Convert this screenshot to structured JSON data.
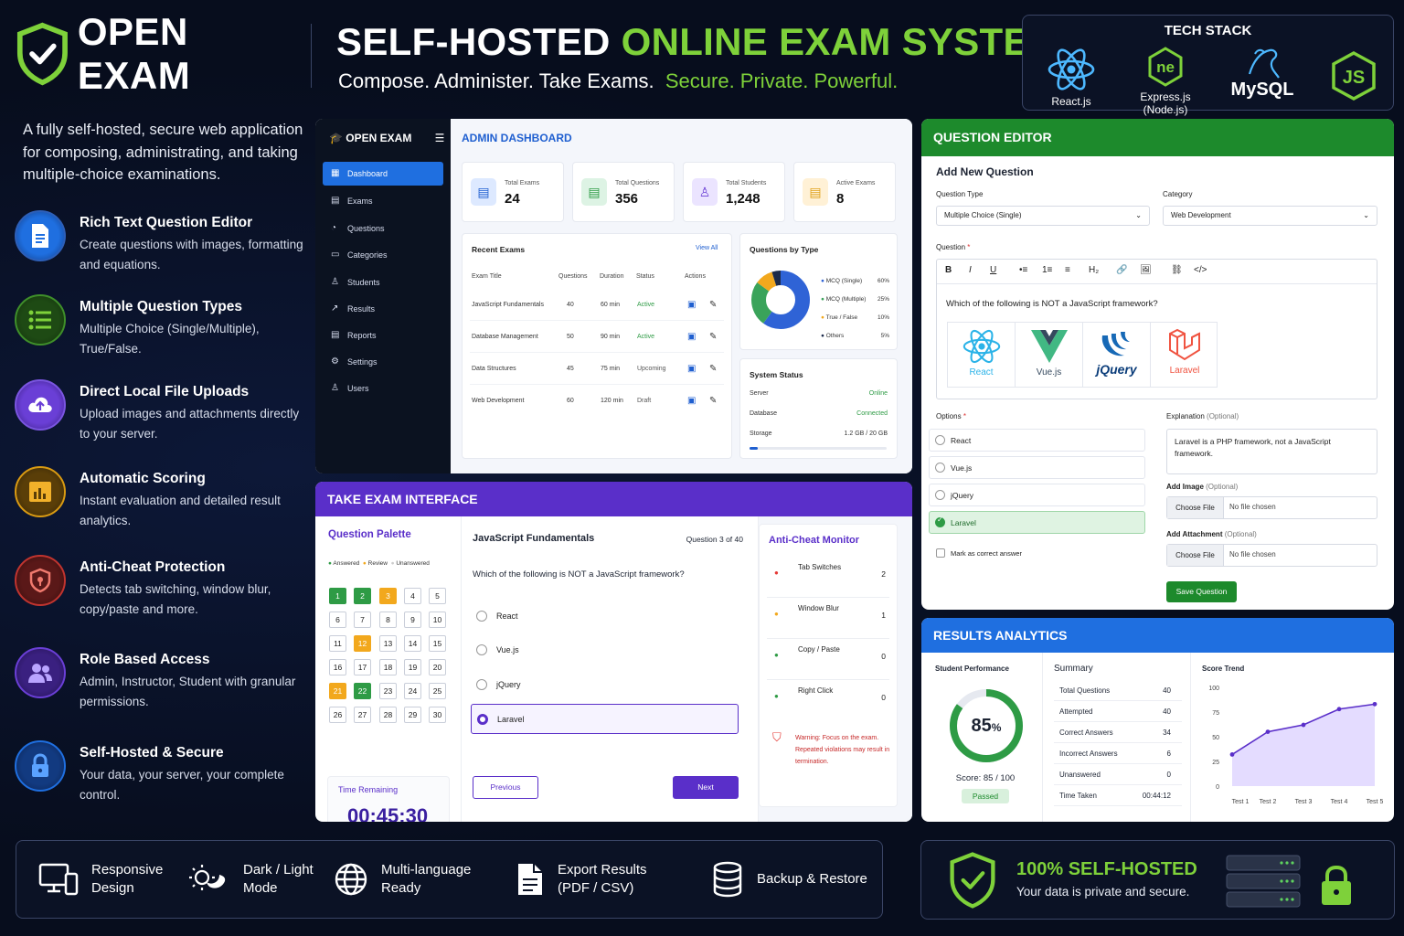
{
  "brand": {
    "name": "OPEN EXAM"
  },
  "headline": {
    "part1": "SELF-HOSTED",
    "part2": "ONLINE EXAM SYSTEM"
  },
  "tagline": {
    "part1": "Compose. Administer. Take Exams.",
    "part2": "Secure. Private. Powerful."
  },
  "tech_stack": {
    "title": "TECH STACK",
    "items": [
      {
        "label": "React.js",
        "icon": "react-icon"
      },
      {
        "label": "Express.js (Node.js)",
        "icon": "node-icon"
      },
      {
        "label": "MySQL",
        "icon": "mysql-icon"
      },
      {
        "label": "",
        "icon": "js-icon"
      }
    ]
  },
  "intro": "A fully self-hosted, secure web application for composing, administrating, and taking multiple-choice examinations.",
  "features": [
    {
      "title": "Rich Text Question Editor",
      "desc": "Create questions with images, formatting and equations.",
      "icon": "document-icon",
      "color": "#1f6fe0"
    },
    {
      "title": "Multiple Question Types",
      "desc": "Multiple Choice (Single/Multiple), True/False.",
      "icon": "list-icon",
      "color": "#3f8f2a"
    },
    {
      "title": "Direct Local File Uploads",
      "desc": "Upload images and attachments directly to your server.",
      "icon": "cloud-upload-icon",
      "color": "#6a3fd6"
    },
    {
      "title": "Automatic Scoring",
      "desc": "Instant evaluation and detailed result analytics.",
      "icon": "chart-icon",
      "color": "#d99a12"
    },
    {
      "title": "Anti-Cheat Protection",
      "desc": "Detects tab switching, window blur, copy/paste and more.",
      "icon": "shield-icon",
      "color": "#c0342f"
    },
    {
      "title": "Role Based Access",
      "desc": "Admin, Instructor, Student with granular permissions.",
      "icon": "users-icon",
      "color": "#6a3fd6"
    },
    {
      "title": "Self-Hosted & Secure",
      "desc": "Your data, your server, your complete control.",
      "icon": "lock-icon",
      "color": "#1f6fe0"
    }
  ],
  "admin": {
    "logo": "OPEN EXAM",
    "title": "ADMIN DASHBOARD",
    "menu": [
      "Dashboard",
      "Exams",
      "Questions",
      "Categories",
      "Students",
      "Results",
      "Reports",
      "Settings",
      "Users"
    ],
    "stats": [
      {
        "label": "Total Exams",
        "value": "24"
      },
      {
        "label": "Total Questions",
        "value": "356"
      },
      {
        "label": "Total Students",
        "value": "1,248"
      },
      {
        "label": "Active Exams",
        "value": "8"
      }
    ],
    "recent": {
      "title": "Recent Exams",
      "view_all": "View All",
      "headers": [
        "Exam Title",
        "Questions",
        "Duration",
        "Status",
        "Actions"
      ],
      "rows": [
        [
          "JavaScript Fundamentals",
          "40",
          "60 min",
          "Active"
        ],
        [
          "Database Management",
          "50",
          "90 min",
          "Active"
        ],
        [
          "Data Structures",
          "45",
          "75 min",
          "Upcoming"
        ],
        [
          "Web Development",
          "60",
          "120 min",
          "Draft"
        ]
      ]
    },
    "by_type": {
      "title": "Questions by Type",
      "items": [
        {
          "label": "MCQ (Single)",
          "value": "60%",
          "pct": 60,
          "color": "#2f63d6"
        },
        {
          "label": "MCQ (Multiple)",
          "value": "25%",
          "pct": 25,
          "color": "#3aa35a"
        },
        {
          "label": "True / False",
          "value": "10%",
          "pct": 10,
          "color": "#f2a81d"
        },
        {
          "label": "Others",
          "value": "5%",
          "pct": 5,
          "color": "#1b2a4a"
        }
      ]
    },
    "system": {
      "title": "System Status",
      "rows": [
        {
          "label": "Server",
          "value": "Online"
        },
        {
          "label": "Database",
          "value": "Connected"
        },
        {
          "label": "Storage",
          "value": "1.2 GB / 20 GB"
        }
      ],
      "storage_fraction": 0.06
    }
  },
  "editor": {
    "header": "QUESTION EDITOR",
    "title": "Add New Question",
    "type_label": "Question Type",
    "type_value": "Multiple Choice (Single)",
    "cat_label": "Category",
    "cat_value": "Web Development",
    "question_label": "Question",
    "required": "*",
    "toolbar": [
      "B",
      "I",
      "U",
      "•≡",
      "1≡",
      "≡",
      "H₂",
      "🔗",
      "🖼",
      "⛓",
      "</>"
    ],
    "question_text": "Which of the following is NOT a JavaScript framework?",
    "logos": [
      "React",
      "Vue.js",
      "jQuery",
      "Laravel"
    ],
    "options_label": "Options",
    "options": [
      "React",
      "Vue.js",
      "jQuery",
      "Laravel"
    ],
    "mark_correct": "Mark as correct answer",
    "explanation_label": "Explanation",
    "optional": "(Optional)",
    "explanation_text": "Laravel is a PHP framework, not a JavaScript framework.",
    "add_image": "Add Image",
    "add_attachment": "Add Attachment",
    "choose": "Choose File",
    "no_file": "No file chosen",
    "save": "Save Question"
  },
  "take": {
    "header": "TAKE EXAM INTERFACE",
    "palette_title": "Question Palette",
    "legend": [
      "Answered",
      "Review",
      "Unanswered"
    ],
    "numbers": [
      {
        "n": "1",
        "s": "a"
      },
      {
        "n": "2",
        "s": "a"
      },
      {
        "n": "3",
        "s": "r"
      },
      {
        "n": "4",
        "s": "u"
      },
      {
        "n": "5",
        "s": "u"
      },
      {
        "n": "6",
        "s": "u"
      },
      {
        "n": "7",
        "s": "u"
      },
      {
        "n": "8",
        "s": "u"
      },
      {
        "n": "9",
        "s": "u"
      },
      {
        "n": "10",
        "s": "u"
      },
      {
        "n": "11",
        "s": "u"
      },
      {
        "n": "12",
        "s": "r"
      },
      {
        "n": "13",
        "s": "u"
      },
      {
        "n": "14",
        "s": "u"
      },
      {
        "n": "15",
        "s": "u"
      },
      {
        "n": "16",
        "s": "u"
      },
      {
        "n": "17",
        "s": "u"
      },
      {
        "n": "18",
        "s": "u"
      },
      {
        "n": "19",
        "s": "u"
      },
      {
        "n": "20",
        "s": "u"
      },
      {
        "n": "21",
        "s": "r"
      },
      {
        "n": "22",
        "s": "a"
      },
      {
        "n": "23",
        "s": "u"
      },
      {
        "n": "24",
        "s": "u"
      },
      {
        "n": "25",
        "s": "u"
      },
      {
        "n": "26",
        "s": "u"
      },
      {
        "n": "27",
        "s": "u"
      },
      {
        "n": "28",
        "s": "u"
      },
      {
        "n": "29",
        "s": "u"
      },
      {
        "n": "30",
        "s": "u"
      }
    ],
    "time_label": "Time Remaining",
    "time": "00:45:30",
    "exam_title": "JavaScript Fundamentals",
    "progress": "Question 3 of 40",
    "question": "Which of the following is NOT a JavaScript framework?",
    "options": [
      "React",
      "Vue.js",
      "jQuery",
      "Laravel"
    ],
    "prev": "Previous",
    "next": "Next",
    "monitor_title": "Anti-Cheat Monitor",
    "monitor": [
      {
        "label": "Tab Switches",
        "count": "2",
        "color": "#e53935"
      },
      {
        "label": "Window Blur",
        "count": "1",
        "color": "#f2a81d"
      },
      {
        "label": "Copy / Paste",
        "count": "0",
        "color": "#2e9b45"
      },
      {
        "label": "Right Click",
        "count": "0",
        "color": "#2e9b45"
      }
    ],
    "warning": "Warning: Focus on the exam. Repeated violations may result in termination."
  },
  "results": {
    "header": "RESULTS ANALYTICS",
    "perf_title": "Student Performance",
    "percent": "85",
    "percent_sign": "%",
    "score": "Score: 85 / 100",
    "passed": "Passed",
    "summary_title": "Summary",
    "summary": [
      [
        "Total Questions",
        "40"
      ],
      [
        "Attempted",
        "40"
      ],
      [
        "Correct Answers",
        "34"
      ],
      [
        "Incorrect Answers",
        "6"
      ],
      [
        "Unanswered",
        "0"
      ],
      [
        "Time Taken",
        "00:44:12"
      ]
    ],
    "trend_title": "Score Trend"
  },
  "chart_data": {
    "type": "area",
    "title": "Score Trend",
    "x": [
      "Test 1",
      "Test 2",
      "Test 3",
      "Test 4",
      "Test 5"
    ],
    "values": [
      32,
      55,
      62,
      78,
      83
    ],
    "yticks": [
      "0",
      "25",
      "50",
      "75",
      "100"
    ],
    "ylim": [
      0,
      100
    ]
  },
  "bottom": [
    {
      "label": "Responsive Design",
      "icon": "devices-icon"
    },
    {
      "label": "Dark / Light Mode",
      "icon": "theme-icon"
    },
    {
      "label": "Multi-language Ready",
      "icon": "globe-icon"
    },
    {
      "label": "Export Results (PDF / CSV)",
      "icon": "file-icon"
    },
    {
      "label": "Backup & Restore",
      "icon": "database-icon"
    }
  ],
  "selfhosted": {
    "title": "100% SELF-HOSTED",
    "subtitle": "Your data is private and secure."
  }
}
